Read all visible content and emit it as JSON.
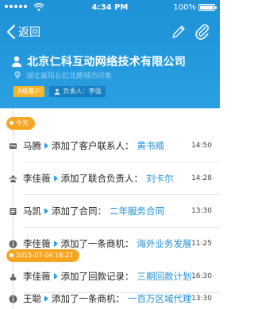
{
  "status_bar": {
    "time": "4:34 PM",
    "battery": "100%"
  },
  "nav": {
    "back_label": "返回"
  },
  "company": {
    "name": "北京仁科互动网络技术有限公司",
    "address": "湖北襄阳长虹北路城市印象",
    "level_tag": "A级客户",
    "owner_tag": "负责人：李强"
  },
  "colors": {
    "header": "#2a9fe1",
    "accent_orange": "#f6a623",
    "link": "#1d8fd8"
  },
  "timeline": {
    "groups": [
      {
        "date": "今天",
        "items": [
          {
            "icon": "contact-card-icon",
            "user": "马腾",
            "action": "添加了客户联系人：",
            "target": "黄书顺",
            "time": "14:50"
          },
          {
            "icon": "people-icon",
            "user": "李佳薇",
            "action": "添加了联合负责人：",
            "target": "刘卡尔",
            "time": "14:28"
          },
          {
            "icon": "contract-icon",
            "user": "马凯",
            "action": "添加了合同：",
            "target": "二年服务合同",
            "time": "13:30"
          },
          {
            "icon": "info-icon",
            "user": "李佳薇",
            "action": "添加了一条商机：",
            "target": "海外业务发展",
            "time": "11:25"
          }
        ]
      },
      {
        "date": "2015-07-04  18:27",
        "items": [
          {
            "icon": "payment-icon",
            "user": "李佳薇",
            "action": "添加了回款记录：",
            "target": "三期回款计划",
            "time": "16:30"
          },
          {
            "icon": "info-icon",
            "user": "王聪",
            "action": "添加了一条商机：",
            "target": "一百万区域代理",
            "time": "13:30"
          }
        ]
      }
    ]
  }
}
